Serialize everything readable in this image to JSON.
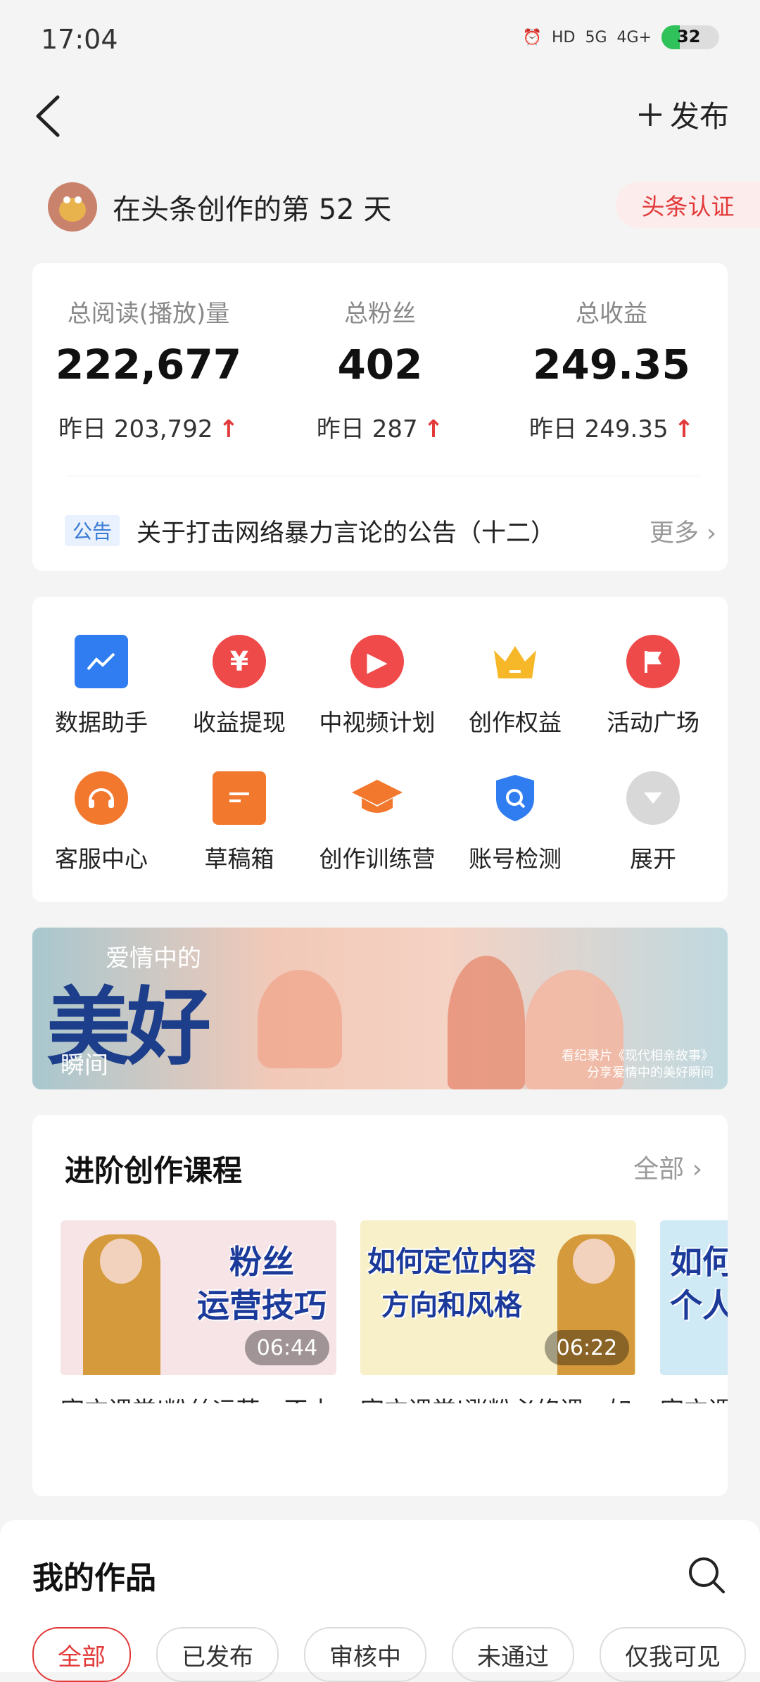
{
  "status_bar": {
    "time": "17:04",
    "signal_1": "HD",
    "signal_2": "5G",
    "signal_3": "4G+",
    "battery": "32"
  },
  "top_bar": {
    "publish_label": "发布"
  },
  "creator": {
    "days_text": "在头条创作的第 52 天",
    "badge": "头条认证"
  },
  "stats": [
    {
      "label": "总阅读(播放)量",
      "value": "222,677",
      "yesterday": "昨日 203,792"
    },
    {
      "label": "总粉丝",
      "value": "402",
      "yesterday": "昨日 287"
    },
    {
      "label": "总收益",
      "value": "249.35",
      "yesterday": "昨日 249.35"
    }
  ],
  "notice": {
    "tag": "公告",
    "text": "关于打击网络暴力言论的公告（十二）",
    "more": "更多"
  },
  "tools": [
    {
      "label": "数据助手",
      "icon": "chart-icon",
      "color": "#2f7df0"
    },
    {
      "label": "收益提现",
      "icon": "yen-icon",
      "color": "#ef4a4a"
    },
    {
      "label": "中视频计划",
      "icon": "play-icon",
      "color": "#f14a4a"
    },
    {
      "label": "创作权益",
      "icon": "crown-icon",
      "color": "#f6b829"
    },
    {
      "label": "活动广场",
      "icon": "flag-icon",
      "color": "#ef4a4a"
    },
    {
      "label": "客服中心",
      "icon": "headset-icon",
      "color": "#f2782e"
    },
    {
      "label": "草稿箱",
      "icon": "draft-icon",
      "color": "#f2782e"
    },
    {
      "label": "创作训练营",
      "icon": "graduation-cap-icon",
      "color": "#f2782e"
    },
    {
      "label": "账号检测",
      "icon": "shield-search-icon",
      "color": "#2f7df0"
    },
    {
      "label": "展开",
      "icon": "expand-down-icon",
      "color": "#d8d8d8"
    }
  ],
  "banner": {
    "title_small": "爱情中的",
    "title_big": "美好",
    "title_sub": "瞬间",
    "caption_1": "看纪录片《现代相亲故事》",
    "caption_2": "分享爱情中的美好瞬间"
  },
  "courses": {
    "heading": "进阶创作课程",
    "all_label": "全部",
    "items": [
      {
        "thumb_title_1": "粉丝",
        "thumb_title_2": "运营技巧",
        "duration": "06:44",
        "title": "官方课堂|粉丝运营，不止回个评论这么简单",
        "bg": "#f7e4e6"
      },
      {
        "thumb_title_1": "如何定位内容",
        "thumb_title_2": "方向和风格",
        "duration": "06:22",
        "title": "官方课堂|涨粉必修课：如何定位，内容方向和风格",
        "bg": "#f7f0c8"
      },
      {
        "thumb_title_1": "如何",
        "thumb_title_2": "个人",
        "title": "官方课堂|如何做？打",
        "bg": "#cfe9f5"
      }
    ]
  },
  "works": {
    "heading": "我的作品",
    "tabs": [
      "全部",
      "已发布",
      "审核中",
      "未通过",
      "仅我可见"
    ]
  }
}
